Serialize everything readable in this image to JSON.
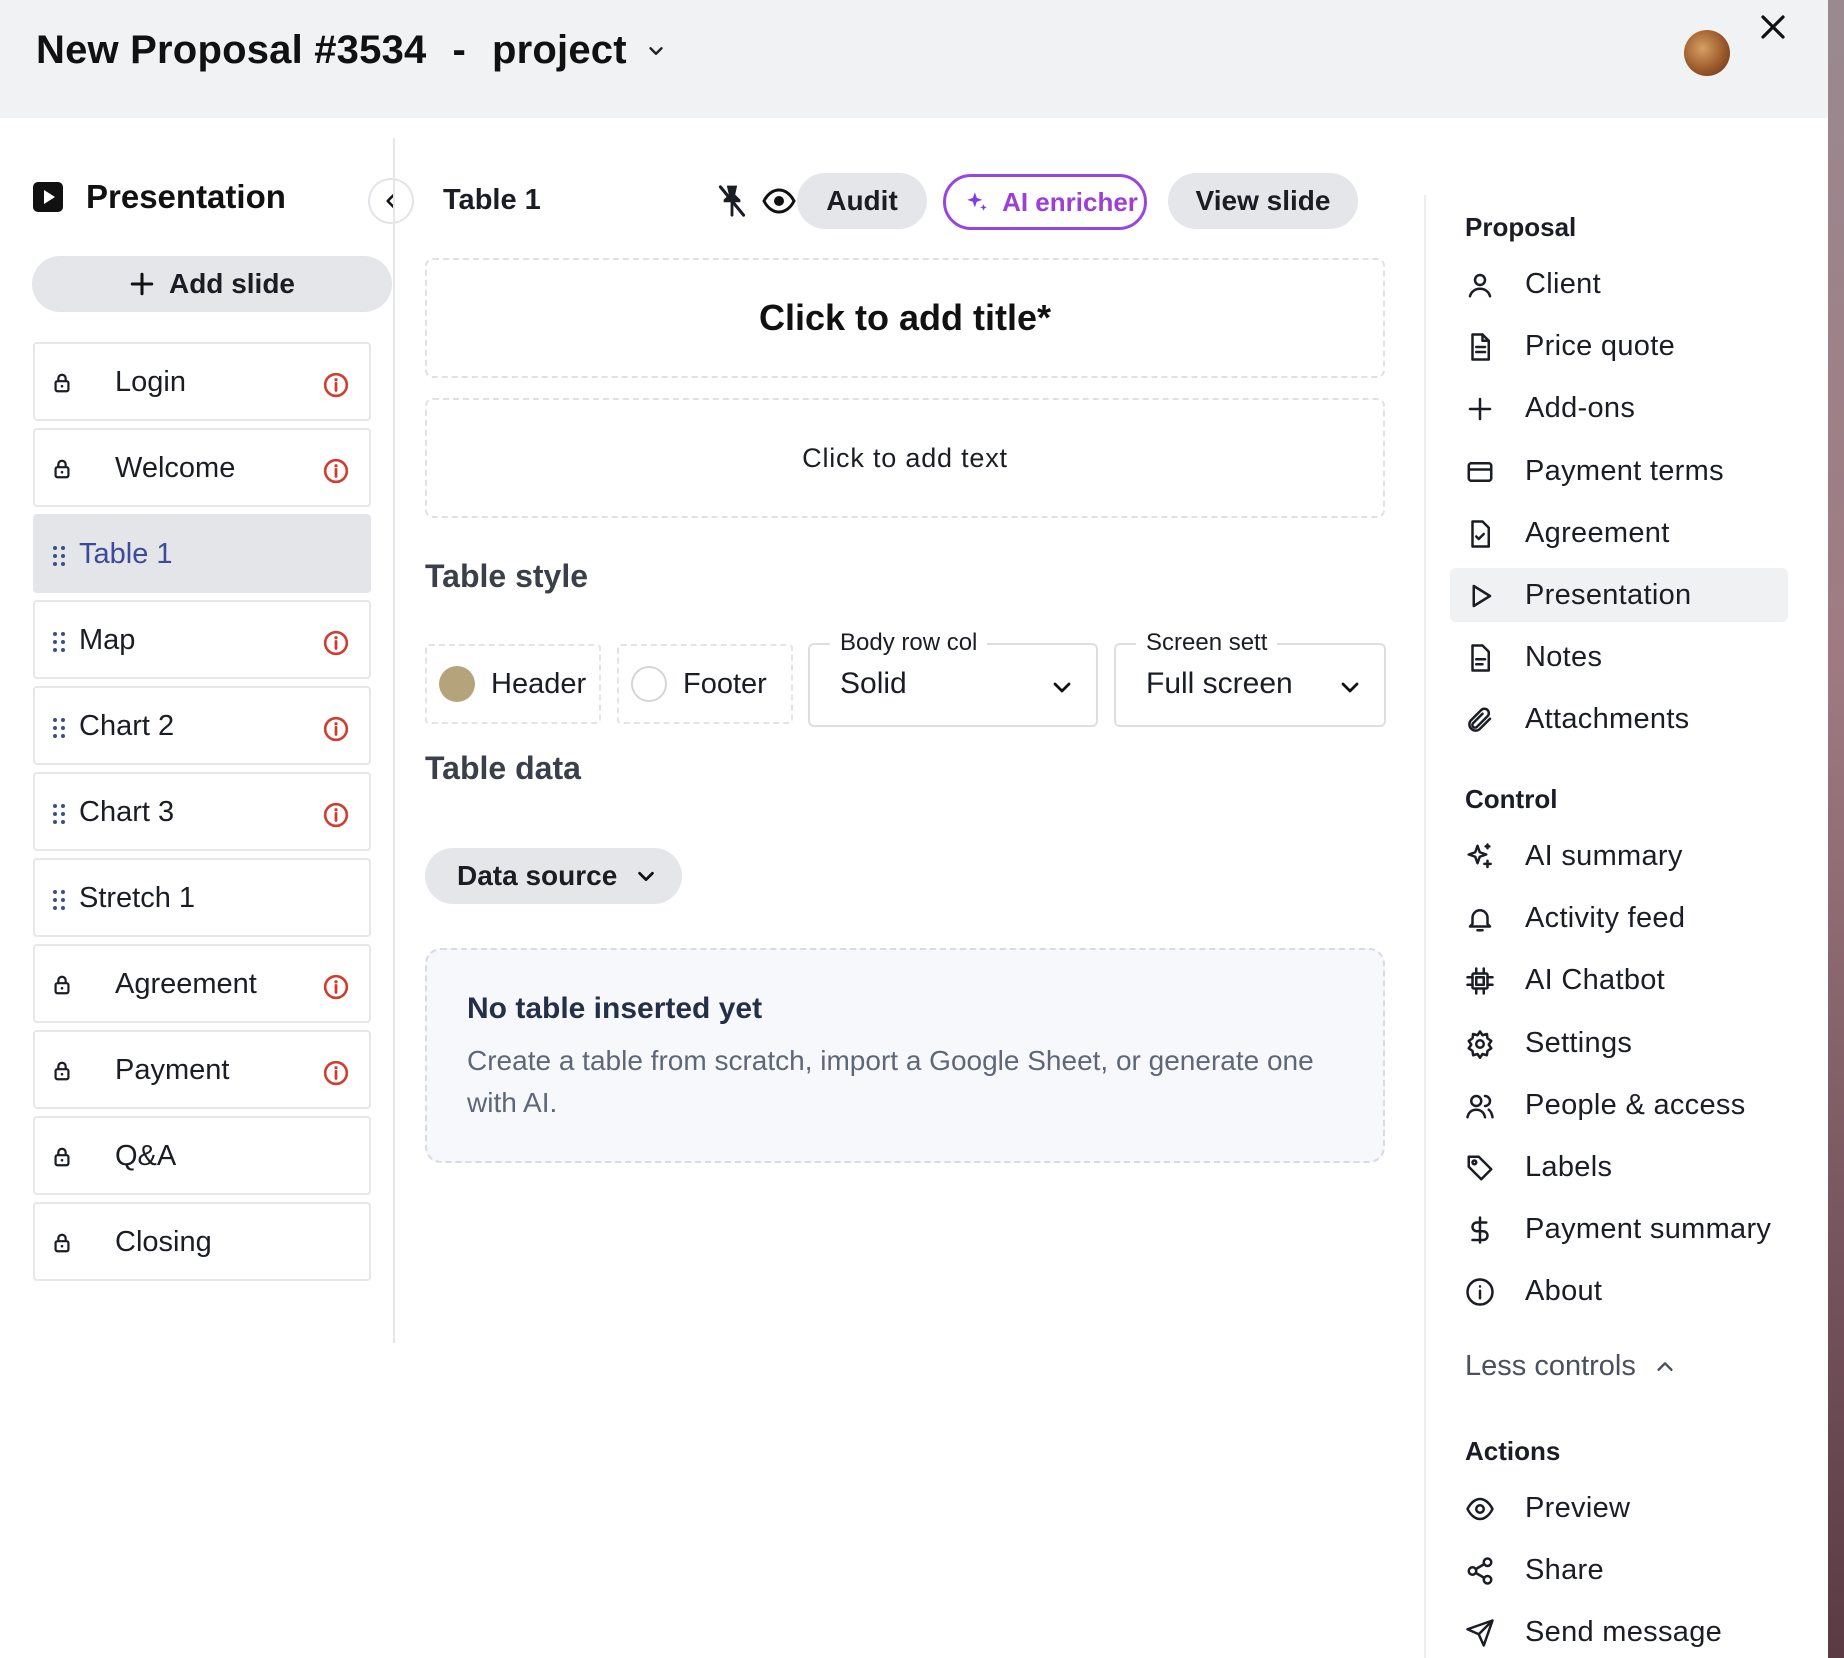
{
  "header": {
    "proposal_title": "New Proposal #3534",
    "separator": "-",
    "project": "project"
  },
  "sidebar": {
    "title": "Presentation",
    "add_slide": "Add slide",
    "slides": [
      {
        "label": "Login",
        "locked": true,
        "warning": true
      },
      {
        "label": "Welcome",
        "locked": true,
        "warning": true
      },
      {
        "label": "Table 1",
        "locked": false,
        "warning": false,
        "active": true
      },
      {
        "label": "Map",
        "locked": false,
        "warning": true
      },
      {
        "label": "Chart 2",
        "locked": false,
        "warning": true
      },
      {
        "label": "Chart 3",
        "locked": false,
        "warning": true
      },
      {
        "label": "Stretch 1",
        "locked": false,
        "warning": false
      },
      {
        "label": "Agreement",
        "locked": true,
        "warning": true
      },
      {
        "label": "Payment",
        "locked": true,
        "warning": true
      },
      {
        "label": "Q&A",
        "locked": true,
        "warning": false
      },
      {
        "label": "Closing",
        "locked": true,
        "warning": false
      }
    ]
  },
  "editor": {
    "slide_name": "Table 1",
    "audit": "Audit",
    "ai_enricher": "AI enricher",
    "view_slide": "View slide",
    "title_placeholder": "Click to add title*",
    "text_placeholder": "Click to add text",
    "table_style_heading": "Table style",
    "header_option": "Header",
    "footer_option": "Footer",
    "body_row_label": "Body row col",
    "body_row_value": "Solid",
    "screen_label": "Screen sett",
    "screen_value": "Full screen",
    "table_data_heading": "Table data",
    "data_source": "Data source",
    "empty_title": "No table inserted yet",
    "empty_desc": "Create a table from scratch, import a Google Sheet, or generate one with AI.",
    "header_color": "#b5a47b"
  },
  "nav": {
    "proposal_heading": "Proposal",
    "proposal_items": [
      "Client",
      "Price quote",
      "Add-ons",
      "Payment terms",
      "Agreement",
      "Presentation",
      "Notes",
      "Attachments"
    ],
    "control_heading": "Control",
    "control_items": [
      "AI summary",
      "Activity feed",
      "AI Chatbot",
      "Settings",
      "People & access",
      "Labels",
      "Payment summary",
      "About"
    ],
    "less_controls": "Less controls",
    "actions_heading": "Actions",
    "action_items": [
      "Preview",
      "Share",
      "Send message"
    ]
  }
}
